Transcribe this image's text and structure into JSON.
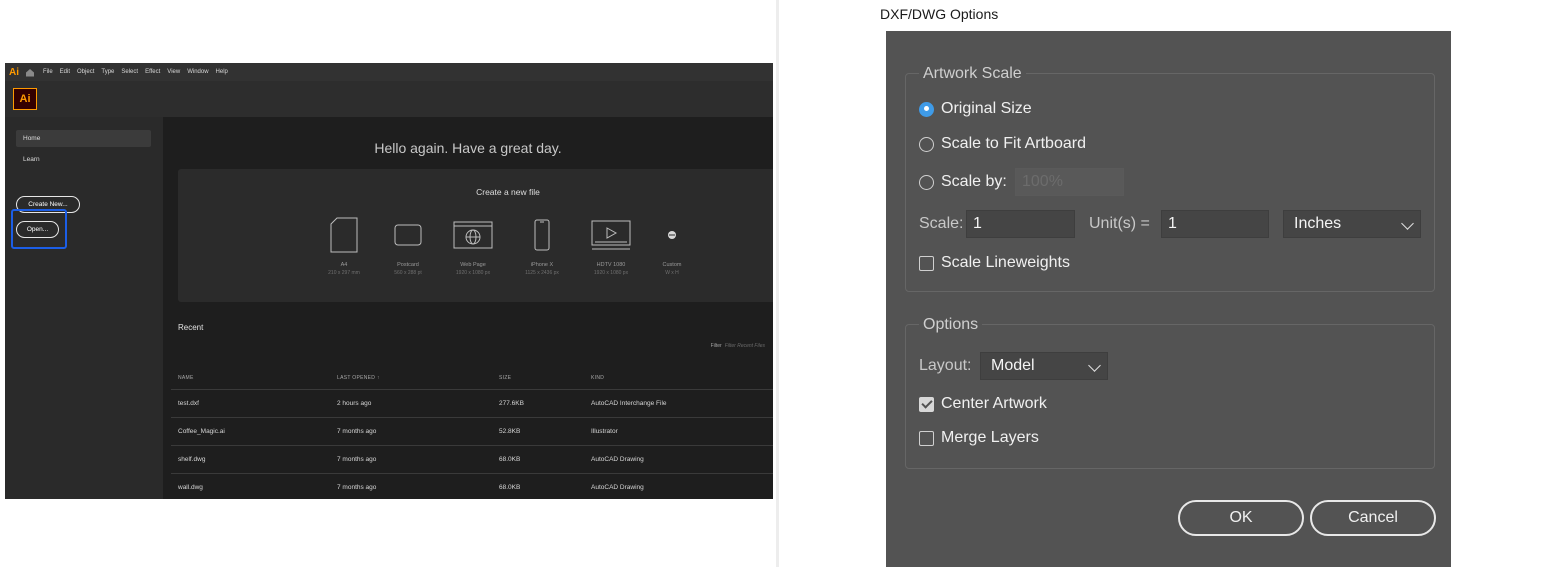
{
  "illustrator": {
    "app_mark": "Ai",
    "menu": [
      "File",
      "Edit",
      "Object",
      "Type",
      "Select",
      "Effect",
      "View",
      "Window",
      "Help"
    ],
    "logo": "Ai",
    "sidebar": {
      "home": "Home",
      "learn": "Learn",
      "create_new": "Create New...",
      "open": "Open..."
    },
    "greeting": "Hello again. Have a great day.",
    "create": {
      "title": "Create a new file",
      "presets": [
        {
          "name": "A4",
          "dims": "210 x 297 mm",
          "icon": "document-portrait-icon"
        },
        {
          "name": "Postcard",
          "dims": "560 x 288 pt",
          "icon": "postcard-icon"
        },
        {
          "name": "Web Page",
          "dims": "1920 x 1080 px",
          "icon": "web-globe-icon"
        },
        {
          "name": "iPhone X",
          "dims": "1125 x 2436 px",
          "icon": "phone-icon"
        },
        {
          "name": "HDTV 1080",
          "dims": "1920 x 1080 px",
          "icon": "video-screen-icon"
        },
        {
          "name": "Custom",
          "dims": "W x H",
          "icon": "custom-dot-icon"
        }
      ]
    },
    "recent": {
      "title": "Recent",
      "filter_label": "Filter",
      "filter_placeholder": "Filter Recent Files",
      "columns": [
        "NAME",
        "LAST OPENED",
        "SIZE",
        "KIND"
      ],
      "sort_indicator": "↑",
      "rows": [
        {
          "name": "test.dxf",
          "opened": "2 hours ago",
          "size": "277.6KB",
          "kind": "AutoCAD Interchange File"
        },
        {
          "name": "Coffee_Magic.ai",
          "opened": "7 months ago",
          "size": "52.8KB",
          "kind": "Illustrator"
        },
        {
          "name": "shelf.dwg",
          "opened": "7 months ago",
          "size": "68.0KB",
          "kind": "AutoCAD Drawing"
        },
        {
          "name": "wall.dwg",
          "opened": "7 months ago",
          "size": "68.0KB",
          "kind": "AutoCAD Drawing"
        }
      ]
    },
    "highlight_color": "#1c5ee6"
  },
  "dialog": {
    "title": "DXF/DWG Options",
    "artwork_scale": {
      "legend": "Artwork Scale",
      "original_size": "Original Size",
      "scale_to_fit": "Scale to Fit Artboard",
      "scale_by": "Scale by:",
      "scale_by_value": "100%",
      "selected": "original_size",
      "scale_label": "Scale:",
      "scale_value": "1",
      "units_label": "Unit(s) =",
      "units_value": "1",
      "unit_select": "Inches",
      "scale_lineweights": "Scale Lineweights",
      "scale_lineweights_checked": false
    },
    "options": {
      "legend": "Options",
      "layout_label": "Layout:",
      "layout_value": "Model",
      "center_artwork": "Center Artwork",
      "center_artwork_checked": true,
      "merge_layers": "Merge Layers",
      "merge_layers_checked": false
    },
    "ok": "OK",
    "cancel": "Cancel",
    "accent": "#3f9be8"
  }
}
